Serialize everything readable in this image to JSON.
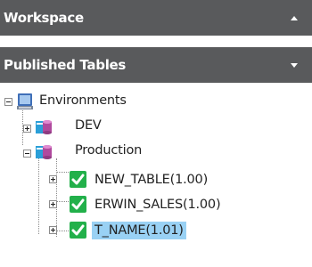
{
  "panels": {
    "workspace": {
      "title": "Workspace",
      "state": "collapsed"
    },
    "published_tables": {
      "title": "Published Tables",
      "state": "expanded"
    }
  },
  "tree": {
    "root": {
      "label": "Environments",
      "icon": "computer-icon",
      "expanded": true
    },
    "environments": [
      {
        "label": "DEV",
        "icon": "database-icon",
        "expanded": false
      },
      {
        "label": "Production",
        "icon": "database-icon",
        "expanded": true
      }
    ],
    "tables": [
      {
        "label": "NEW_TABLE(1.00)",
        "icon": "green-check-icon",
        "selected": false
      },
      {
        "label": "ERWIN_SALES(1.00)",
        "icon": "green-check-icon",
        "selected": false
      },
      {
        "label": "T_NAME(1.01)",
        "icon": "green-check-icon",
        "selected": true
      }
    ]
  },
  "colors": {
    "header_bg": "#595a5c",
    "selection": "#99d1f4",
    "check_green": "#22b04a"
  }
}
